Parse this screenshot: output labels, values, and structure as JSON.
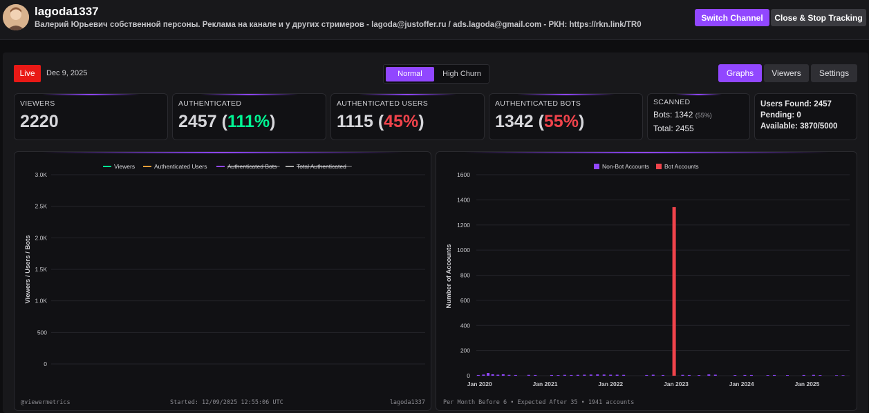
{
  "header": {
    "title": "lagoda1337",
    "description": "Валерий Юрьевич собственной персоны. Реклама на канале и у других стримеров - lagoda@justoffer.ru / ads.lagoda@gmail.com  -   РКН: https://rkn.link/TR0",
    "switch_label": "Switch Channel",
    "close_label": "Close & Stop Tracking"
  },
  "status": {
    "live_label": "Live",
    "date": "Dec 9, 2025"
  },
  "mode": {
    "normal": "Normal",
    "high_churn": "High Churn"
  },
  "tabs": {
    "graphs": "Graphs",
    "viewers": "Viewers",
    "settings": "Settings"
  },
  "stats": {
    "viewers": {
      "label": "VIEWERS",
      "value": "2220"
    },
    "authenticated": {
      "label": "AUTHENTICATED",
      "value": "2457",
      "pct": "111%"
    },
    "auth_users": {
      "label": "AUTHENTICATED USERS",
      "value": "1115",
      "pct": "45%"
    },
    "auth_bots": {
      "label": "AUTHENTICATED BOTS",
      "value": "1342",
      "pct": "55%"
    },
    "scanned": {
      "label": "SCANNED",
      "bots_label": "Bots:",
      "bots_value": "1342",
      "bots_pct": "(55%)",
      "total_label": "Total:",
      "total_value": "2455"
    },
    "found": {
      "users_found": "Users Found: 2457",
      "pending": "Pending: 0",
      "available": "Available: 3870/5000"
    }
  },
  "colors": {
    "accent": "#9147ff",
    "live": "#e91916",
    "green": "#00f593",
    "red": "#f0434b",
    "orange": "#f29d38",
    "gray": "#aaaaaa"
  },
  "chart_data": [
    {
      "type": "line",
      "title": "",
      "ylabel": "Viewers / Users / Bots",
      "ylim": [
        0,
        3000
      ],
      "y_ticks": [
        "0",
        "500",
        "1.0K",
        "1.5K",
        "2.0K",
        "2.5K",
        "3.0K"
      ],
      "series": [
        {
          "name": "Viewers",
          "color": "#00f593",
          "hidden": false,
          "values": []
        },
        {
          "name": "Authenticated Users",
          "color": "#f29d38",
          "hidden": false,
          "values": []
        },
        {
          "name": "Authenticated Bots",
          "color": "#9147ff",
          "hidden": true,
          "values": []
        },
        {
          "name": "Total Authenticated",
          "color": "#aaaaaa",
          "hidden": true,
          "values": []
        }
      ],
      "footer": {
        "left": "@viewermetrics",
        "center": "Started: 12/09/2025 12:55:06 UTC",
        "right": "lagoda1337"
      }
    },
    {
      "type": "bar",
      "title": "",
      "ylabel": "Number of Accounts",
      "ylim": [
        0,
        1600
      ],
      "y_ticks": [
        "0",
        "200",
        "400",
        "600",
        "800",
        "1000",
        "1200",
        "1400",
        "1600"
      ],
      "x_ticks": [
        "Jan 2020",
        "Jan 2021",
        "Jan 2022",
        "Jan 2023",
        "Jan 2024",
        "Jan 2025"
      ],
      "x_start_year": 2019.95,
      "x_end_year": 2025.65,
      "series": [
        {
          "name": "Non-Bot Accounts",
          "color": "#9147ff"
        },
        {
          "name": "Bot Accounts",
          "color": "#f0434b"
        }
      ],
      "non_bot": [
        [
          2019.98,
          6
        ],
        [
          2020.06,
          9
        ],
        [
          2020.13,
          22
        ],
        [
          2020.2,
          11
        ],
        [
          2020.28,
          8
        ],
        [
          2020.36,
          11
        ],
        [
          2020.45,
          7
        ],
        [
          2020.55,
          6
        ],
        [
          2020.75,
          7
        ],
        [
          2020.85,
          6
        ],
        [
          2021.1,
          6
        ],
        [
          2021.2,
          5
        ],
        [
          2021.3,
          7
        ],
        [
          2021.4,
          6
        ],
        [
          2021.5,
          7
        ],
        [
          2021.6,
          8
        ],
        [
          2021.7,
          9
        ],
        [
          2021.8,
          10
        ],
        [
          2021.9,
          9
        ],
        [
          2022.0,
          8
        ],
        [
          2022.1,
          8
        ],
        [
          2022.2,
          7
        ],
        [
          2022.55,
          6
        ],
        [
          2022.65,
          8
        ],
        [
          2022.8,
          6
        ],
        [
          2023.1,
          7
        ],
        [
          2023.2,
          6
        ],
        [
          2023.35,
          5
        ],
        [
          2023.5,
          10
        ],
        [
          2023.6,
          8
        ],
        [
          2023.9,
          5
        ],
        [
          2024.05,
          6
        ],
        [
          2024.15,
          6
        ],
        [
          2024.4,
          5
        ],
        [
          2024.5,
          6
        ],
        [
          2024.7,
          5
        ],
        [
          2024.95,
          6
        ],
        [
          2025.1,
          7
        ],
        [
          2025.2,
          5
        ],
        [
          2025.45,
          4
        ],
        [
          2025.55,
          4
        ]
      ],
      "bot": [
        [
          2022.97,
          1342
        ]
      ],
      "footer": {
        "left": "Per Month Before 6 • Expected After 35 • 1941 accounts"
      }
    }
  ]
}
